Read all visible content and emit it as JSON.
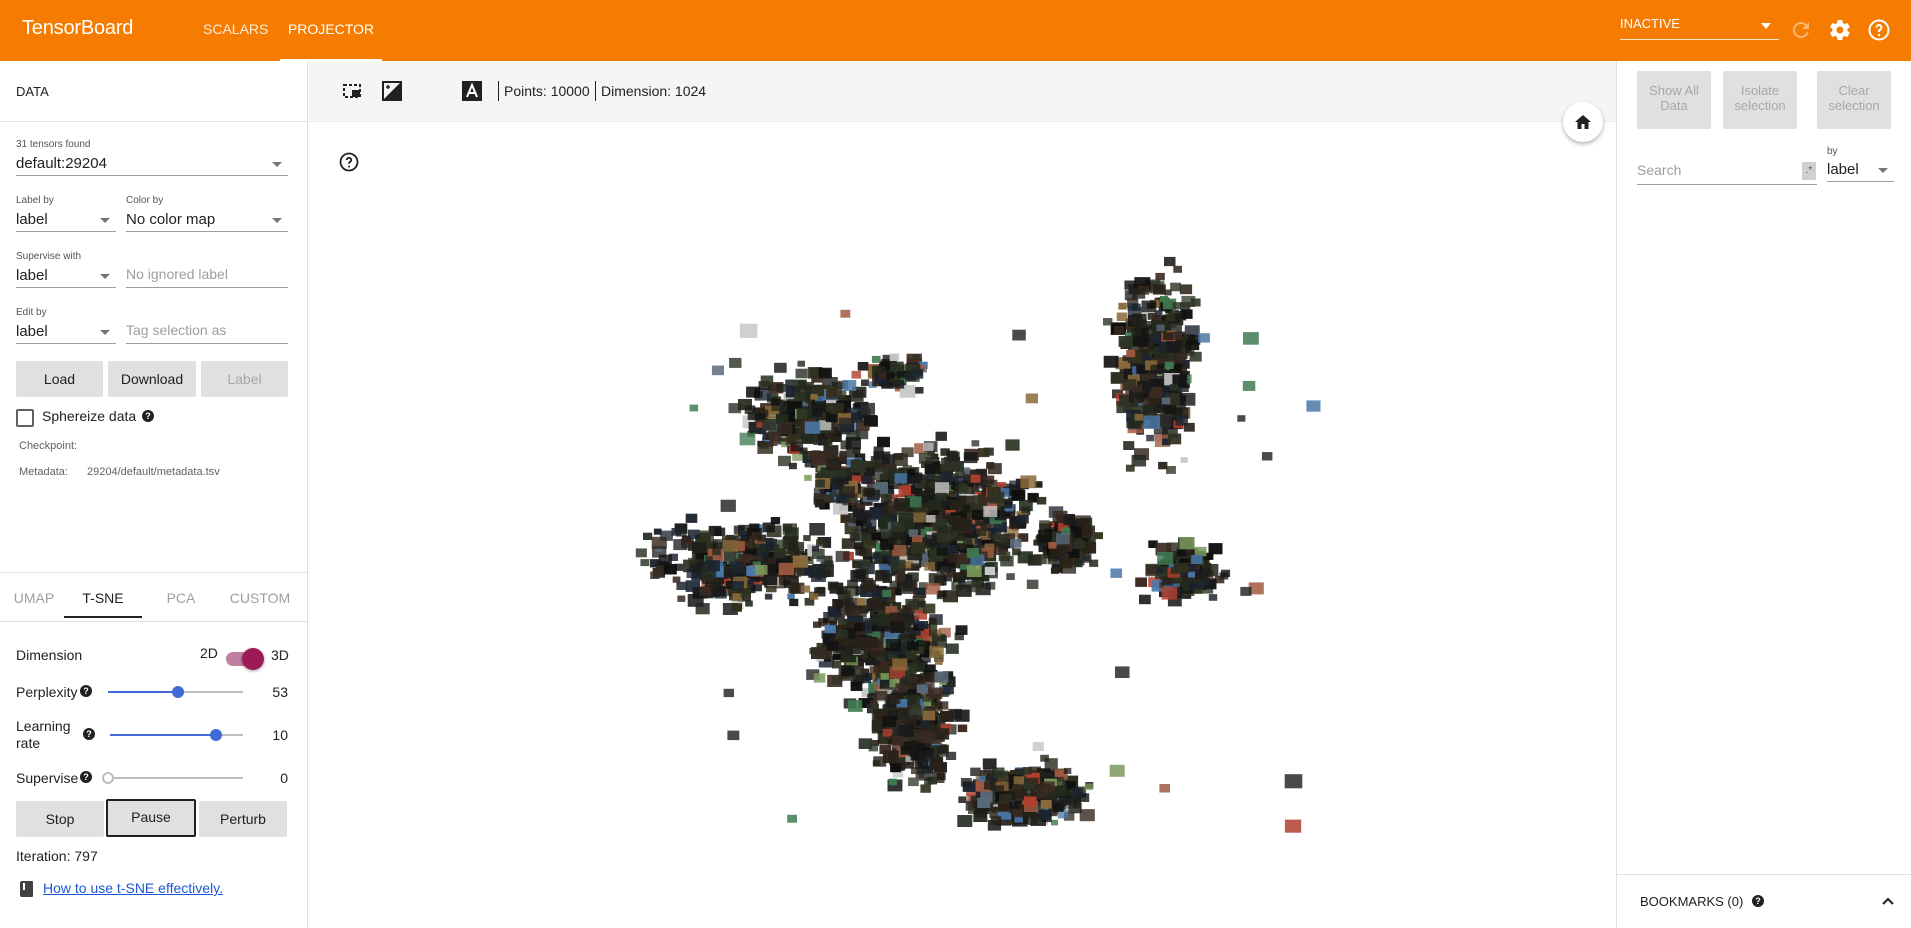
{
  "app": {
    "brand": "TensorBoard",
    "tabs": [
      {
        "label": "SCALARS",
        "active": false
      },
      {
        "label": "PROJECTOR",
        "active": true
      }
    ],
    "run_status": "INACTIVE",
    "accent_color": "#f57c00"
  },
  "data_panel": {
    "title": "DATA",
    "tensors_found": "31 tensors found",
    "tensor_value": "default:29204",
    "label_by_label": "Label by",
    "label_by_value": "label",
    "color_by_label": "Color by",
    "color_by_value": "No color map",
    "supervise_with_label": "Supervise with",
    "supervise_with_value": "label",
    "ignored_label_placeholder": "No ignored label",
    "edit_by_label": "Edit by",
    "edit_by_value": "label",
    "tag_selection_placeholder": "Tag selection as",
    "load_label": "Load",
    "download_label": "Download",
    "label_btn_label": "Label",
    "sphereize_label": "Sphereize data",
    "sphereize_checked": false,
    "checkpoint_label": "Checkpoint:",
    "metadata_label": "Metadata:",
    "metadata_value": "29204/default/metadata.tsv"
  },
  "projection_tabs": [
    {
      "label": "UMAP",
      "active": false
    },
    {
      "label": "T-SNE",
      "active": true
    },
    {
      "label": "PCA",
      "active": false
    },
    {
      "label": "CUSTOM",
      "active": false
    }
  ],
  "tsne": {
    "dimension_label": "Dimension",
    "dim_2d": "2D",
    "dim_3d": "3D",
    "dimension_is_3d": true,
    "perplexity_label": "Perplexity",
    "perplexity_value": "53",
    "perplexity_fraction": 0.52,
    "learning_rate_label_1": "Learning",
    "learning_rate_label_2": "rate",
    "learning_rate_value": "10",
    "learning_rate_fraction": 0.8,
    "supervise_label": "Supervise",
    "supervise_value": "0",
    "supervise_fraction": 0,
    "stop_label": "Stop",
    "pause_label": "Pause",
    "perturb_label": "Perturb",
    "iteration": "Iteration: 797",
    "help_link": "How to use t-SNE effectively."
  },
  "toolbar": {
    "points": "Points: 10000",
    "dimension": "Dimension: 1024"
  },
  "inspector": {
    "show_all_1": "Show All",
    "show_all_2": "Data",
    "isolate_1": "Isolate",
    "isolate_2": "selection",
    "clear_1": "Clear",
    "clear_2": "selection",
    "search_placeholder": "Search",
    "regex_glyph": ".*",
    "by_label": "by",
    "by_value": "label",
    "bookmarks": "BOOKMARKS (0)"
  }
}
